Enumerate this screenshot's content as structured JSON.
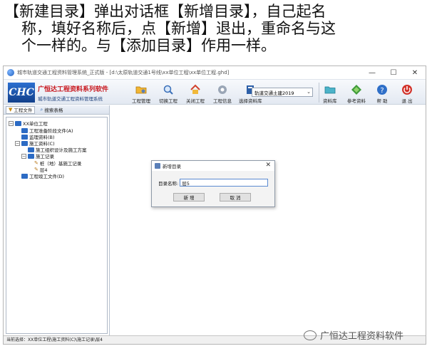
{
  "caption": {
    "lines": [
      "【新建目录】弹出对话框【新增目录】，自己起名",
      "称，填好名称后，点【新增】退出，重命名与这",
      "个一样的。与【添加目录】作用一样。"
    ]
  },
  "window": {
    "title": "城市轨道交通工程资料管理系统_正式版 - [d:\\太原轨道交通1号线\\xx单位工程\\xx单位工程.ghd]",
    "controls": [
      "—",
      "☐",
      "✕"
    ]
  },
  "logo": {
    "mark": "CHC",
    "name": "广恒达工程资料系列软件",
    "subtitle": "城市轨道交通工程资料管理系统"
  },
  "toolbar": {
    "project_manage": "工程管理",
    "switch_project": "切换工程",
    "close_project": "关闭工程",
    "project_info": "工程信息",
    "select_library": "选择资料库",
    "library_value": "轨道交通土建2019",
    "resource_library": "资料库",
    "reference": "参考资料",
    "help": "帮 助",
    "exit": "退 出"
  },
  "sidebar": {
    "tabs": [
      "工程文件",
      "搜索表格"
    ],
    "tree": [
      {
        "label": "XX单位工程",
        "level": 0,
        "expander": "−"
      },
      {
        "label": "工程准备阶段文件(A)",
        "level": 1,
        "expander": ""
      },
      {
        "label": "监理资料(B)",
        "level": 1,
        "expander": ""
      },
      {
        "label": "施工资料(C)",
        "level": 1,
        "expander": "−"
      },
      {
        "label": "施工组织设计及施工方案",
        "level": 2,
        "expander": ""
      },
      {
        "label": "施工记录",
        "level": 2,
        "expander": "−"
      },
      {
        "label": "桩（地）基施工记录",
        "level": 3,
        "expander": ""
      },
      {
        "label": "层4",
        "level": 3,
        "expander": ""
      },
      {
        "label": "工程竣工文件(D)",
        "level": 1,
        "expander": ""
      }
    ]
  },
  "dialog": {
    "title": "新增目录",
    "close": "✕",
    "field_label": "目录名称:",
    "field_value": "层5",
    "ok_label": "新 增",
    "cancel_label": "取 消"
  },
  "statusbar": {
    "text": "当前选择：XX单位工程\\施工资料(C)\\施工记录\\层4"
  },
  "watermark": {
    "text": "广恒达工程资料软件"
  },
  "icons": {
    "project_manage": "folder-gear-icon",
    "switch_project": "magnifier-icon",
    "close_project": "house-icon",
    "project_info": "gear-icon",
    "select_library": "book-icon",
    "resource_library": "folder-icon",
    "reference": "diamond-icon",
    "help": "question-icon",
    "exit": "power-icon"
  },
  "colors": {
    "brand_red": "#c8161d",
    "brand_blue": "#1d3f7a",
    "tree_book": "#2c6bc4"
  }
}
